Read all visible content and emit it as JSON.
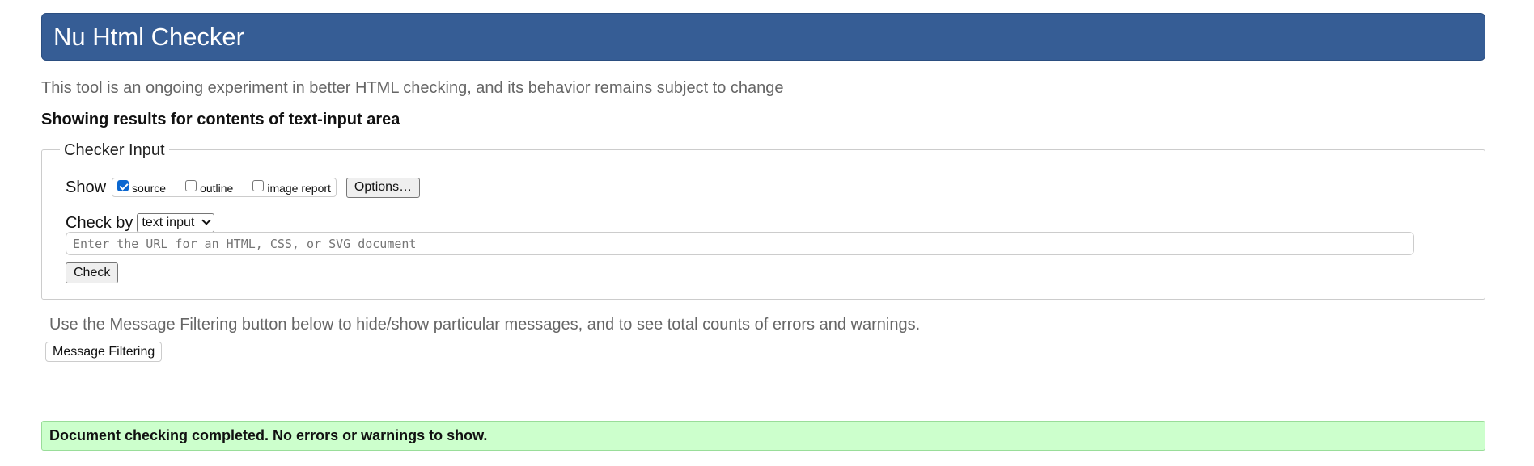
{
  "header": {
    "title": "Nu Html Checker"
  },
  "tagline": "This tool is an ongoing experiment in better HTML checking, and its behavior remains subject to change",
  "results_heading": "Showing results for contents of text-input area",
  "checker_input": {
    "legend": "Checker Input",
    "show_label": "Show",
    "show_options": [
      {
        "label": "source",
        "checked": true
      },
      {
        "label": "outline",
        "checked": false
      },
      {
        "label": "image report",
        "checked": false
      }
    ],
    "options_button": "Options…",
    "check_by_label": "Check by",
    "check_by_value": "text input",
    "url_placeholder": "Enter the URL for an HTML, CSS, or SVG document",
    "check_button": "Check"
  },
  "filter_note": "Use the Message Filtering button below to hide/show particular messages, and to see total counts of errors and warnings.",
  "filter_button": "Message Filtering",
  "success_message": "Document checking completed. No errors or warnings to show.",
  "colors": {
    "header_bg": "#365d95",
    "success_bg": "#ccffcc",
    "muted_text": "#666666"
  }
}
